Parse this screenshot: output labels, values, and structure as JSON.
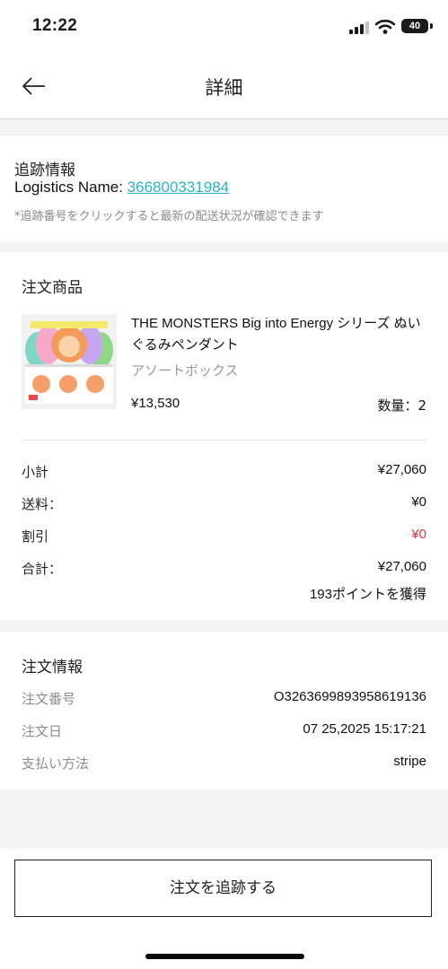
{
  "status_bar": {
    "time": "12:22",
    "battery": "40"
  },
  "nav": {
    "title": "詳細"
  },
  "tracking": {
    "title": "追跡情報",
    "logistics_label": "Logistics Name: ",
    "tracking_number": "366800331984",
    "note": "*追跡番号をクリックすると最新の配送状況が確認できます"
  },
  "products": {
    "title": "注文商品",
    "item": {
      "name": "THE MONSTERS Big into Energy シリーズ ぬいぐるみペンダント",
      "variant": "アソートボックス",
      "price": "¥13,530",
      "quantity": "数量：2"
    },
    "summary": {
      "subtotal_label": "小計",
      "subtotal_value": "¥27,060",
      "shipping_label": "送料：",
      "shipping_value": "¥0",
      "discount_label": "割引",
      "discount_value": "¥0",
      "total_label": "合計：",
      "total_value": "¥27,060",
      "points": "193ポイントを獲得"
    }
  },
  "order_info": {
    "title": "注文情報",
    "order_number_label": "注文番号",
    "order_number_value": "O3263699893958619136",
    "order_date_label": "注文日",
    "order_date_value": "07 25,2025 15:17:21",
    "payment_label": "支払い方法",
    "payment_value": "stripe"
  },
  "footer": {
    "track_button": "注文を追跡する"
  },
  "colors": {
    "link": "#2bb3c6",
    "discount": "#e8333b",
    "background": "#f4f4f4"
  }
}
